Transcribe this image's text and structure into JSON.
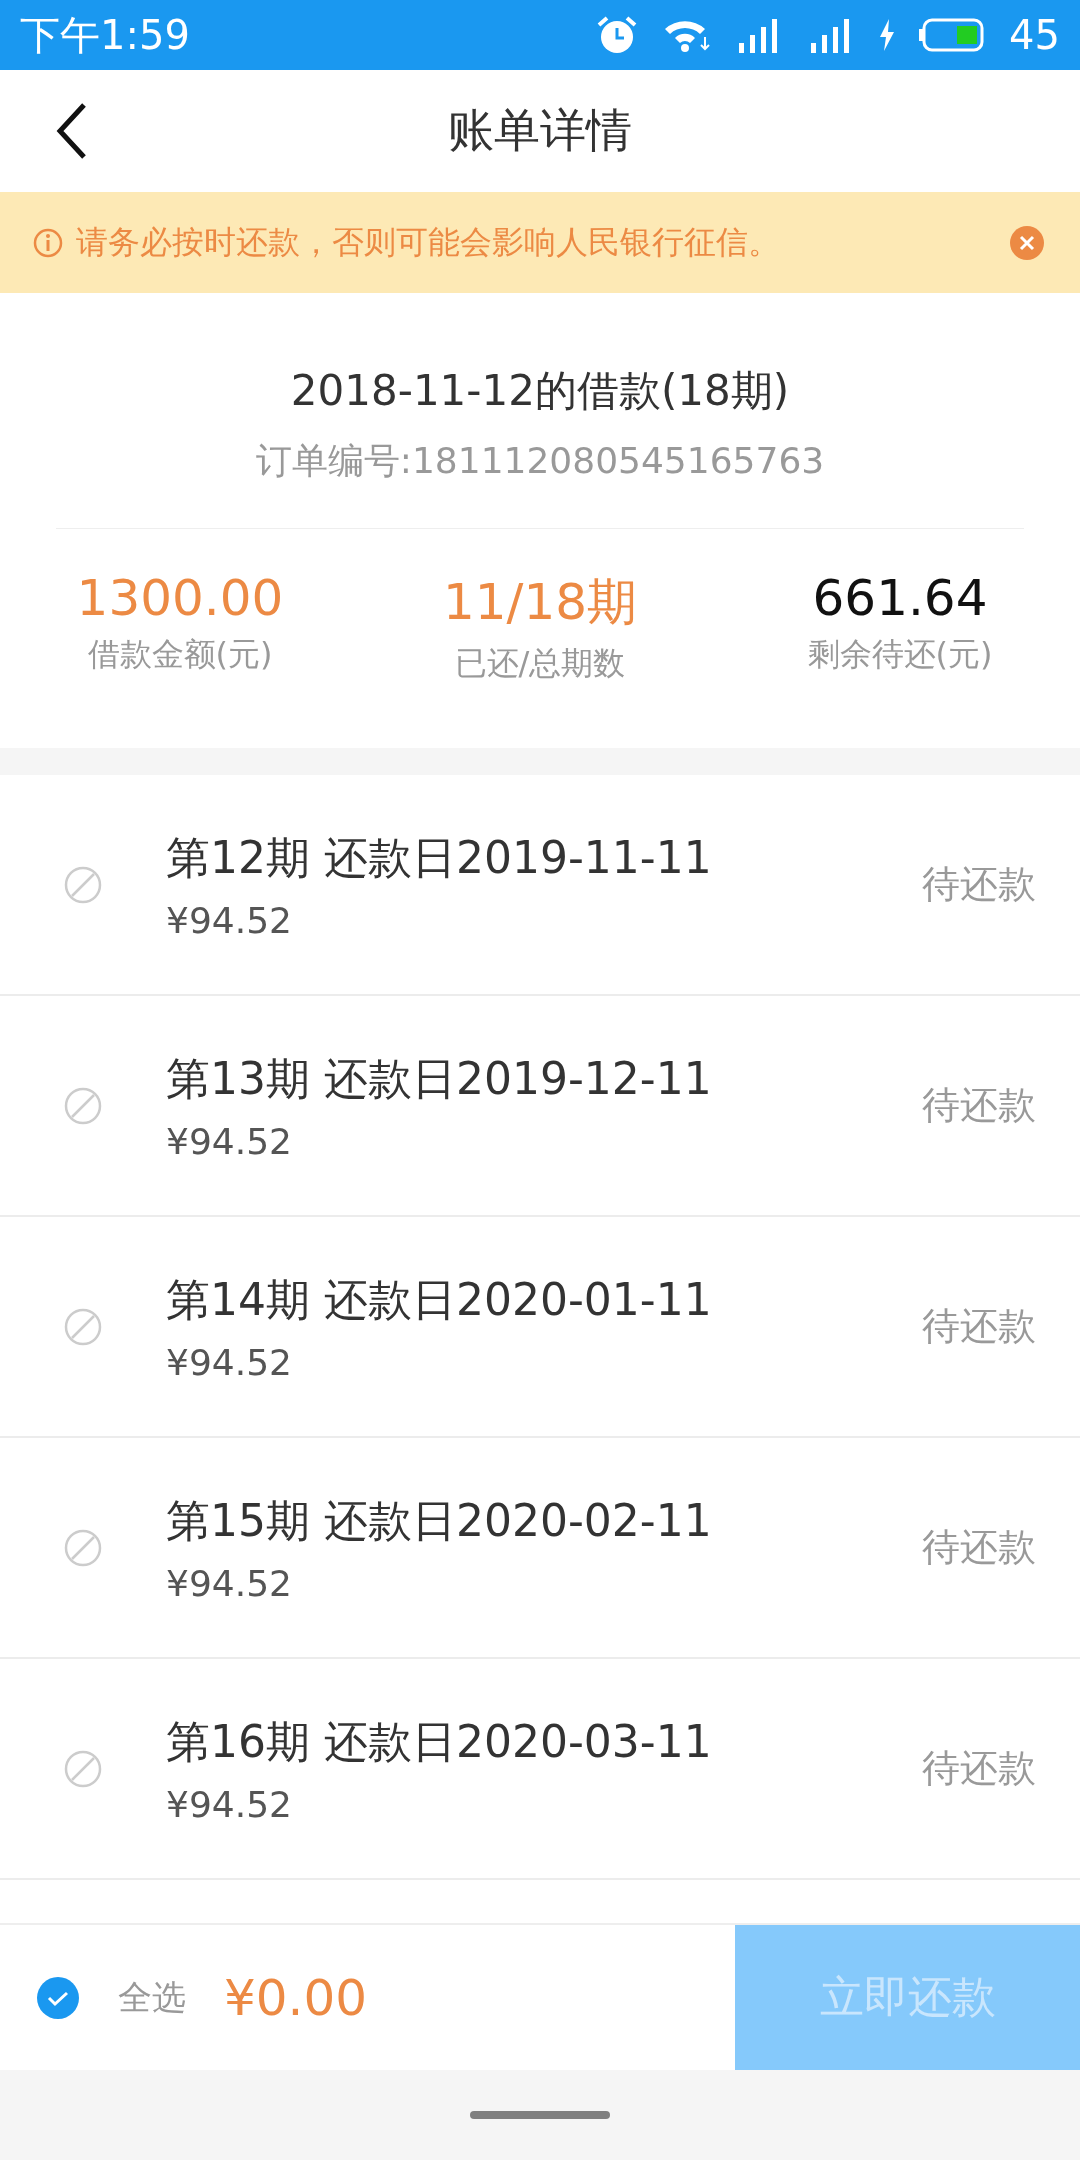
{
  "status_bar": {
    "time": "下午1:59",
    "battery": "45"
  },
  "nav": {
    "title": "账单详情"
  },
  "notice": {
    "text": "请务必按时还款，否则可能会影响人民银行征信。"
  },
  "loan": {
    "title": "2018-11-12的借款(18期)",
    "order_no": "订单编号:181112080545165763",
    "stats": [
      {
        "value": "1300.00",
        "label": "借款金额(元)",
        "highlight": true
      },
      {
        "value": "11/18期",
        "label": "已还/总期数",
        "highlight": true
      },
      {
        "value": "661.64",
        "label": "剩余待还(元)",
        "highlight": false
      }
    ]
  },
  "installments": [
    {
      "title": "第12期 还款日2019-11-11",
      "amount": "¥94.52",
      "status": "待还款",
      "disabled": true
    },
    {
      "title": "第13期 还款日2019-12-11",
      "amount": "¥94.52",
      "status": "待还款",
      "disabled": true
    },
    {
      "title": "第14期 还款日2020-01-11",
      "amount": "¥94.52",
      "status": "待还款",
      "disabled": true
    },
    {
      "title": "第15期 还款日2020-02-11",
      "amount": "¥94.52",
      "status": "待还款",
      "disabled": true
    },
    {
      "title": "第16期 还款日2020-03-11",
      "amount": "¥94.52",
      "status": "待还款",
      "disabled": true
    }
  ],
  "footer": {
    "select_all": {
      "label": "全选",
      "checked": true
    },
    "total": "¥0.00",
    "pay_button": {
      "label": "立即还款",
      "disabled": true
    }
  }
}
